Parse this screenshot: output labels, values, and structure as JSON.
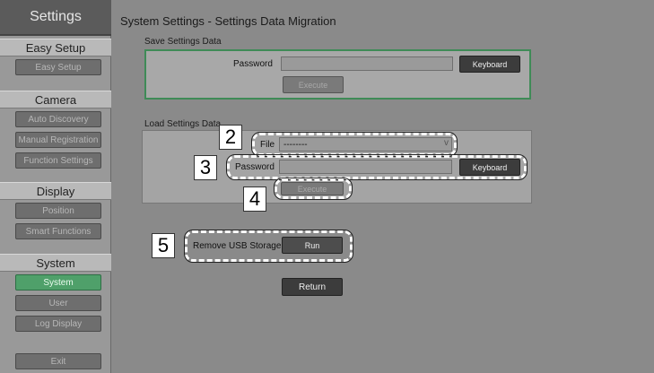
{
  "sidebar": {
    "title": "Settings",
    "sections": [
      {
        "label": "Easy Setup",
        "items": [
          {
            "label": "Easy Setup"
          }
        ]
      },
      {
        "label": "Camera",
        "items": [
          {
            "label": "Auto Discovery"
          },
          {
            "label": "Manual Registration"
          },
          {
            "label": "Function Settings"
          }
        ]
      },
      {
        "label": "Display",
        "items": [
          {
            "label": "Position"
          },
          {
            "label": "Smart Functions"
          }
        ]
      },
      {
        "label": "System",
        "items": [
          {
            "label": "System"
          },
          {
            "label": "User"
          },
          {
            "label": "Log Display"
          }
        ]
      }
    ],
    "exit_label": "Exit",
    "active_item": "System"
  },
  "main": {
    "title": "System Settings - Settings Data Migration",
    "save": {
      "label": "Save Settings Data",
      "password_label": "Password",
      "password_value": "",
      "keyboard_label": "Keyboard",
      "execute_label": "Execute"
    },
    "load": {
      "label": "Load Settings Data",
      "file_label": "File",
      "file_value": "--------",
      "file_arrow": "v",
      "password_label": "Password",
      "password_value": "",
      "keyboard_label": "Keyboard",
      "execute_label": "Execute"
    },
    "remove_usb_label": "Remove USB Storage",
    "run_label": "Run",
    "return_label": "Return"
  },
  "callouts": [
    "2",
    "3",
    "4",
    "5"
  ],
  "colors": {
    "accent": "#4fa06a",
    "panel_border": "#3f8b57"
  }
}
